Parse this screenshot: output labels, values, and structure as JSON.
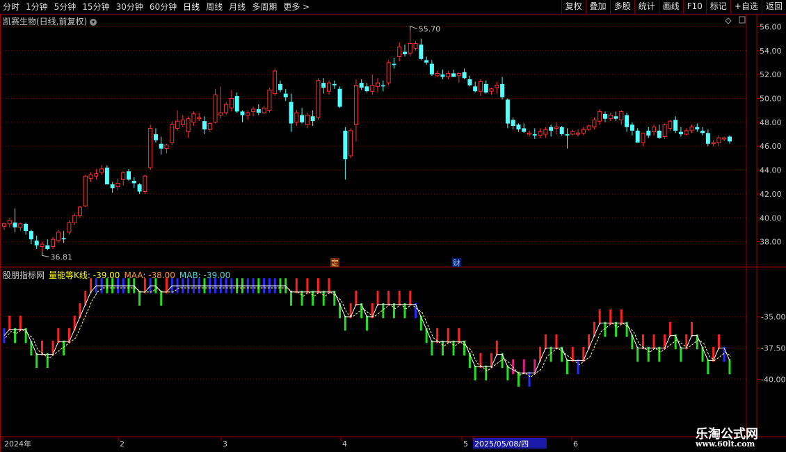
{
  "toolbar": {
    "periods": [
      "分时",
      "1分钟",
      "5分钟",
      "15分钟",
      "30分钟",
      "60分钟",
      "日线",
      "周线",
      "月线",
      "多周期",
      "更多 >"
    ],
    "active_period": "日线",
    "right_buttons": [
      "复权",
      "叠加",
      "多股",
      "统计",
      "画线",
      "F10",
      "标记",
      "+自选",
      "返回"
    ]
  },
  "main_chart": {
    "title": "凯赛生物(日线,前复权)",
    "high_label": "55.70",
    "low_label": "36.81",
    "marker_ding": "定",
    "marker_cai": "财",
    "y_ticks": [
      "56.00",
      "54.00",
      "52.00",
      "50.00",
      "48.00",
      "46.00",
      "44.00",
      "42.00",
      "40.00",
      "38.00"
    ]
  },
  "indicator": {
    "name": "股朋指标网",
    "line1": "量能等K线: -39.00",
    "line2": "MAA: -38.00",
    "line3": "MAB: -39.00",
    "y_ticks": [
      "-35.00",
      "-37.50",
      "-40.00"
    ]
  },
  "x_axis": {
    "labels": [
      "2024年",
      "2",
      "3",
      "4",
      "5",
      "2025/05/08/四",
      "6"
    ]
  },
  "watermark": {
    "brand": "乐淘公式网",
    "url": "www.60lt.com"
  },
  "colors": {
    "up": "#ff3232",
    "down": "#54ffff",
    "grid": "#6e1414",
    "frame": "#a00000"
  },
  "chart_data": {
    "type": "candlestick",
    "title": "凯赛生物(日线,前复权)",
    "ylim": [
      36,
      56.5
    ],
    "candles": [
      [
        39.3,
        39.6,
        39.0,
        39.5
      ],
      [
        39.5,
        40.0,
        39.2,
        39.8
      ],
      [
        39.6,
        40.8,
        38.8,
        39.2
      ],
      [
        39.2,
        39.6,
        38.9,
        39.5
      ],
      [
        39.5,
        39.6,
        38.6,
        38.9
      ],
      [
        38.9,
        39.0,
        37.8,
        38.2
      ],
      [
        38.1,
        38.5,
        37.4,
        37.7
      ],
      [
        37.6,
        38.0,
        37.2,
        37.8
      ],
      [
        37.7,
        38.2,
        37.3,
        37.4
      ],
      [
        37.6,
        38.4,
        37.4,
        38.2
      ],
      [
        38.1,
        39.0,
        37.9,
        38.8
      ],
      [
        38.3,
        38.9,
        37.9,
        38.2
      ],
      [
        38.8,
        39.8,
        38.6,
        39.6
      ],
      [
        39.6,
        40.4,
        39.4,
        40.2
      ],
      [
        40.2,
        41.0,
        40.0,
        40.9
      ],
      [
        41.0,
        43.6,
        40.9,
        43.5
      ],
      [
        43.3,
        43.8,
        43.0,
        43.6
      ],
      [
        43.5,
        44.1,
        43.2,
        43.7
      ],
      [
        43.8,
        44.4,
        43.6,
        44.1
      ],
      [
        44.2,
        44.4,
        42.8,
        42.8
      ],
      [
        42.8,
        43.0,
        42.1,
        42.5
      ],
      [
        42.6,
        43.3,
        42.3,
        42.9
      ],
      [
        43.2,
        43.9,
        42.7,
        43.8
      ],
      [
        43.9,
        44.1,
        43.1,
        43.2
      ],
      [
        43.1,
        43.4,
        42.5,
        42.9
      ],
      [
        42.8,
        42.9,
        42.0,
        42.2
      ],
      [
        42.2,
        43.6,
        42.0,
        43.5
      ],
      [
        44.2,
        47.8,
        44.0,
        47.5
      ],
      [
        47.0,
        47.5,
        46.3,
        46.5
      ],
      [
        46.2,
        46.8,
        45.3,
        45.8
      ],
      [
        45.8,
        46.2,
        45.4,
        46.1
      ],
      [
        46.3,
        48.1,
        46.1,
        47.8
      ],
      [
        47.5,
        49.0,
        47.3,
        48.1
      ],
      [
        47.8,
        48.6,
        47.6,
        48.2
      ],
      [
        47.2,
        48.5,
        46.7,
        48.3
      ],
      [
        48.0,
        48.9,
        47.7,
        48.7
      ],
      [
        48.3,
        48.8,
        48.1,
        48.4
      ],
      [
        48.1,
        48.5,
        47.0,
        47.4
      ],
      [
        47.4,
        48.0,
        47.2,
        47.9
      ],
      [
        48.0,
        50.8,
        47.9,
        50.3
      ],
      [
        48.6,
        51.0,
        48.3,
        48.8
      ],
      [
        48.8,
        49.7,
        48.6,
        49.5
      ],
      [
        49.2,
        50.7,
        48.9,
        50.0
      ],
      [
        50.2,
        50.5,
        48.8,
        48.9
      ],
      [
        48.9,
        49.0,
        48.0,
        48.6
      ],
      [
        48.6,
        49.0,
        48.2,
        48.8
      ],
      [
        48.9,
        49.3,
        48.5,
        49.1
      ],
      [
        49.1,
        49.5,
        48.6,
        48.8
      ],
      [
        48.8,
        49.4,
        48.7,
        49.2
      ],
      [
        49.0,
        50.9,
        48.8,
        50.7
      ],
      [
        50.4,
        52.5,
        50.2,
        52.3
      ],
      [
        51.2,
        51.5,
        50.5,
        50.7
      ],
      [
        50.4,
        50.8,
        49.8,
        50.1
      ],
      [
        49.7,
        50.4,
        47.2,
        47.9
      ],
      [
        48.0,
        49.0,
        47.7,
        48.8
      ],
      [
        48.6,
        49.2,
        47.9,
        48.0
      ],
      [
        47.8,
        48.8,
        47.5,
        48.6
      ],
      [
        48.5,
        49.0,
        47.7,
        48.1
      ],
      [
        48.4,
        51.7,
        48.2,
        51.5
      ],
      [
        51.3,
        51.7,
        50.4,
        50.9
      ],
      [
        50.6,
        51.5,
        50.3,
        51.3
      ],
      [
        51.2,
        51.5,
        50.8,
        51.1
      ],
      [
        50.8,
        51.0,
        49.2,
        49.3
      ],
      [
        47.3,
        47.6,
        43.2,
        44.9
      ],
      [
        45.2,
        47.5,
        45.0,
        47.3
      ],
      [
        47.8,
        51.6,
        46.4,
        51.1
      ],
      [
        51.3,
        51.6,
        50.7,
        50.9
      ],
      [
        51.0,
        51.3,
        50.5,
        50.6
      ],
      [
        50.6,
        52.0,
        50.3,
        51.1
      ],
      [
        51.0,
        51.7,
        50.5,
        51.3
      ],
      [
        51.1,
        51.5,
        50.6,
        51.0
      ],
      [
        51.3,
        53.2,
        51.1,
        53.0
      ],
      [
        52.9,
        53.4,
        52.5,
        52.8
      ],
      [
        53.5,
        54.7,
        53.1,
        54.3
      ],
      [
        53.9,
        54.5,
        53.5,
        53.7
      ],
      [
        53.8,
        55.7,
        53.5,
        54.6
      ],
      [
        54.2,
        54.8,
        54.0,
        54.6
      ],
      [
        54.5,
        55.0,
        53.2,
        53.3
      ],
      [
        53.2,
        53.5,
        52.8,
        53.0
      ],
      [
        52.9,
        53.2,
        51.9,
        52.0
      ],
      [
        51.9,
        52.3,
        51.8,
        52.1
      ],
      [
        52.0,
        52.4,
        51.6,
        51.8
      ],
      [
        51.8,
        52.3,
        51.6,
        52.1
      ],
      [
        52.1,
        52.4,
        51.8,
        51.8
      ],
      [
        51.9,
        52.2,
        51.3,
        52.1
      ],
      [
        52.2,
        52.5,
        51.6,
        51.7
      ],
      [
        51.6,
        51.9,
        51.0,
        51.1
      ],
      [
        51.0,
        51.4,
        50.5,
        50.6
      ],
      [
        50.6,
        51.6,
        50.2,
        51.4
      ],
      [
        51.2,
        51.5,
        50.4,
        50.5
      ],
      [
        50.6,
        50.9,
        50.3,
        50.8
      ],
      [
        50.9,
        51.4,
        50.4,
        51.1
      ],
      [
        51.2,
        51.8,
        49.9,
        50.1
      ],
      [
        49.9,
        50.0,
        47.5,
        47.9
      ],
      [
        48.2,
        48.4,
        47.4,
        47.7
      ],
      [
        47.8,
        47.9,
        47.2,
        47.4
      ],
      [
        47.5,
        47.9,
        47.1,
        47.2
      ],
      [
        47.0,
        47.3,
        46.8,
        47.1
      ],
      [
        47.0,
        47.5,
        46.6,
        46.9
      ],
      [
        46.9,
        47.5,
        46.7,
        47.2
      ],
      [
        47.0,
        47.6,
        46.7,
        47.4
      ],
      [
        47.6,
        47.8,
        46.8,
        47.3
      ],
      [
        47.5,
        48.0,
        47.0,
        47.6
      ],
      [
        47.6,
        47.7,
        46.9,
        47.0
      ],
      [
        47.0,
        47.5,
        45.8,
        46.9
      ],
      [
        47.0,
        47.4,
        46.9,
        47.2
      ],
      [
        47.0,
        47.4,
        46.8,
        47.1
      ],
      [
        47.1,
        47.6,
        46.9,
        47.4
      ],
      [
        47.4,
        47.8,
        47.3,
        47.7
      ],
      [
        47.6,
        48.4,
        47.4,
        48.2
      ],
      [
        48.1,
        49.1,
        47.8,
        48.9
      ],
      [
        48.7,
        48.9,
        48.0,
        48.3
      ],
      [
        48.3,
        48.8,
        48.1,
        48.6
      ],
      [
        48.5,
        48.9,
        48.1,
        48.3
      ],
      [
        48.2,
        49.0,
        47.8,
        48.9
      ],
      [
        48.6,
        48.8,
        47.2,
        47.6
      ],
      [
        47.8,
        48.0,
        46.9,
        47.3
      ],
      [
        47.3,
        47.5,
        46.5,
        46.3
      ],
      [
        46.3,
        47.0,
        46.0,
        47.1
      ],
      [
        47.3,
        47.6,
        46.7,
        46.9
      ],
      [
        47.2,
        47.8,
        46.9,
        47.6
      ],
      [
        47.3,
        47.8,
        46.6,
        46.7
      ],
      [
        46.8,
        47.9,
        46.6,
        47.8
      ],
      [
        47.5,
        48.2,
        47.3,
        48.1
      ],
      [
        48.2,
        48.5,
        47.1,
        47.3
      ],
      [
        47.2,
        47.6,
        46.8,
        47.0
      ],
      [
        47.0,
        47.5,
        46.9,
        47.3
      ],
      [
        47.3,
        47.8,
        47.1,
        47.6
      ],
      [
        47.6,
        47.9,
        47.2,
        47.4
      ],
      [
        47.3,
        47.6,
        46.9,
        47.1
      ],
      [
        47.1,
        47.4,
        46.0,
        46.2
      ],
      [
        46.2,
        46.5,
        46.0,
        46.3
      ],
      [
        46.3,
        46.9,
        46.0,
        46.7
      ],
      [
        46.6,
        46.8,
        46.4,
        46.7
      ],
      [
        46.8,
        46.9,
        46.2,
        46.4
      ]
    ]
  }
}
